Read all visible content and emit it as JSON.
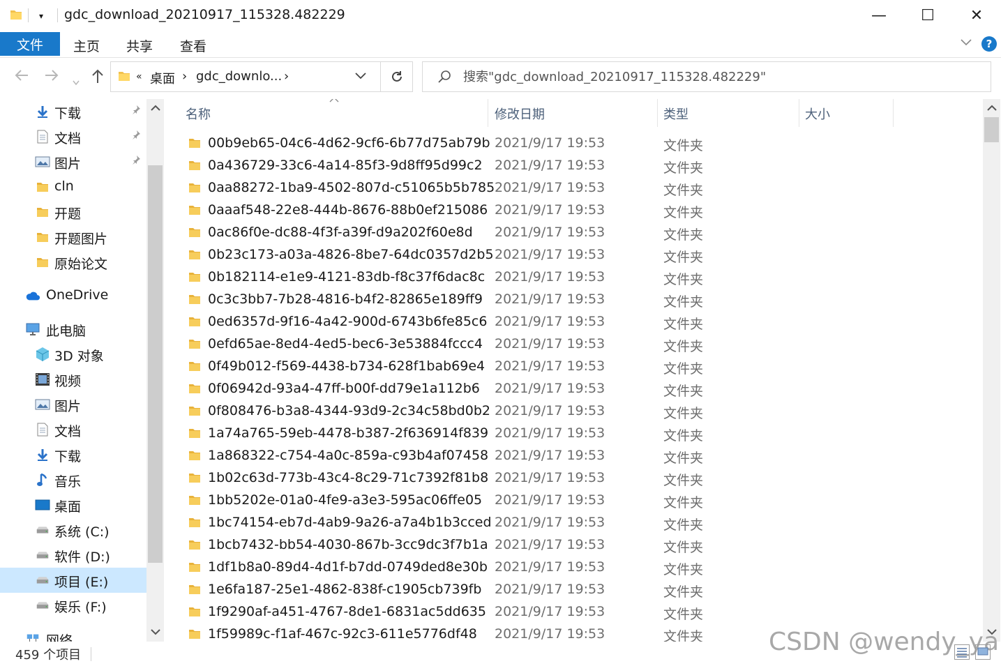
{
  "window": {
    "title": "gdc_download_20210917_115328.482229",
    "minimize": "—",
    "maximize": "☐",
    "close": "✕"
  },
  "ribbon": {
    "tabs": [
      "文件",
      "主页",
      "共享",
      "查看"
    ],
    "help": "?"
  },
  "address": {
    "overflow": "«",
    "crumbs": [
      "桌面",
      "gdc_downlo..."
    ],
    "sep": "›"
  },
  "search": {
    "placeholder": "搜索\"gdc_download_20210917_115328.482229\""
  },
  "nav": {
    "items": [
      {
        "label": "下载",
        "icon": "download-arrow-icon",
        "pinned": true
      },
      {
        "label": "文档",
        "icon": "document-icon",
        "pinned": true
      },
      {
        "label": "图片",
        "icon": "picture-icon",
        "pinned": true
      },
      {
        "label": "cln",
        "icon": "folder-icon"
      },
      {
        "label": "开题",
        "icon": "folder-icon"
      },
      {
        "label": "开题图片",
        "icon": "folder-icon"
      },
      {
        "label": "原始论文",
        "icon": "folder-icon"
      },
      {
        "label": "OneDrive",
        "icon": "cloud-icon"
      },
      {
        "label": "此电脑",
        "icon": "computer-icon"
      },
      {
        "label": "3D 对象",
        "icon": "cube-3d-icon"
      },
      {
        "label": "视频",
        "icon": "video-icon"
      },
      {
        "label": "图片",
        "icon": "picture-icon"
      },
      {
        "label": "文档",
        "icon": "document-icon"
      },
      {
        "label": "下载",
        "icon": "download-arrow-icon"
      },
      {
        "label": "音乐",
        "icon": "music-note-icon"
      },
      {
        "label": "桌面",
        "icon": "desktop-icon"
      },
      {
        "label": "系统 (C:)",
        "icon": "drive-icon"
      },
      {
        "label": "软件 (D:)",
        "icon": "drive-icon"
      },
      {
        "label": "项目 (E:)",
        "icon": "drive-icon",
        "selected": true
      },
      {
        "label": "娱乐 (F:)",
        "icon": "drive-icon"
      },
      {
        "label": "网络",
        "icon": "network-icon"
      }
    ]
  },
  "columns": {
    "name": "名称",
    "date": "修改日期",
    "type": "类型",
    "size": "大小"
  },
  "files": [
    {
      "name": "00b9eb65-04c6-4d62-9cf6-6b77d75ab79b",
      "date": "2021/9/17 19:53",
      "type": "文件夹"
    },
    {
      "name": "0a436729-33c6-4a14-85f3-9d8ff95d99c2",
      "date": "2021/9/17 19:53",
      "type": "文件夹"
    },
    {
      "name": "0aa88272-1ba9-4502-807d-c51065b5b785",
      "date": "2021/9/17 19:53",
      "type": "文件夹"
    },
    {
      "name": "0aaaf548-22e8-444b-8676-88b0ef215086",
      "date": "2021/9/17 19:53",
      "type": "文件夹"
    },
    {
      "name": "0ac86f0e-dc88-4f3f-a39f-d9a202f60e8d",
      "date": "2021/9/17 19:53",
      "type": "文件夹"
    },
    {
      "name": "0b23c173-a03a-4826-8be7-64dc0357d2b5",
      "date": "2021/9/17 19:53",
      "type": "文件夹"
    },
    {
      "name": "0b182114-e1e9-4121-83db-f8c37f6dac8c",
      "date": "2021/9/17 19:53",
      "type": "文件夹"
    },
    {
      "name": "0c3c3bb7-7b28-4816-b4f2-82865e189ff9",
      "date": "2021/9/17 19:53",
      "type": "文件夹"
    },
    {
      "name": "0ed6357d-9f16-4a42-900d-6743b6fe85c6",
      "date": "2021/9/17 19:53",
      "type": "文件夹"
    },
    {
      "name": "0efd65ae-8ed4-4ed5-bec6-3e53884fccc4",
      "date": "2021/9/17 19:53",
      "type": "文件夹"
    },
    {
      "name": "0f49b012-f569-4438-b734-628f1bab69e4",
      "date": "2021/9/17 19:53",
      "type": "文件夹"
    },
    {
      "name": "0f06942d-93a4-47ff-b00f-dd79e1a112b6",
      "date": "2021/9/17 19:53",
      "type": "文件夹"
    },
    {
      "name": "0f808476-b3a8-4344-93d9-2c34c58bd0b2",
      "date": "2021/9/17 19:53",
      "type": "文件夹"
    },
    {
      "name": "1a74a765-59eb-4478-b387-2f636914f839",
      "date": "2021/9/17 19:53",
      "type": "文件夹"
    },
    {
      "name": "1a868322-c754-4a0c-859a-c93b4af07458",
      "date": "2021/9/17 19:53",
      "type": "文件夹"
    },
    {
      "name": "1b02c63d-773b-43c4-8c29-71c7392f81b8",
      "date": "2021/9/17 19:53",
      "type": "文件夹"
    },
    {
      "name": "1bb5202e-01a0-4fe9-a3e3-595ac06ffe05",
      "date": "2021/9/17 19:53",
      "type": "文件夹"
    },
    {
      "name": "1bc74154-eb7d-4ab9-9a26-a7a4b1b3cced",
      "date": "2021/9/17 19:53",
      "type": "文件夹"
    },
    {
      "name": "1bcb7432-bb54-4030-867b-3cc9dc3f7b1a",
      "date": "2021/9/17 19:53",
      "type": "文件夹"
    },
    {
      "name": "1df1b8a0-89d4-4d1f-b7dd-0749ded8e30b",
      "date": "2021/9/17 19:53",
      "type": "文件夹"
    },
    {
      "name": "1e6fa187-25e1-4862-838f-c1905cb739fb",
      "date": "2021/9/17 19:53",
      "type": "文件夹"
    },
    {
      "name": "1f9290af-a451-4767-8de1-6831ac5dd635",
      "date": "2021/9/17 19:53",
      "type": "文件夹"
    },
    {
      "name": "1f59989c-f1af-467c-92c3-611e5776df48",
      "date": "2021/9/17 19:53",
      "type": "文件夹"
    }
  ],
  "status": {
    "count": "459 个项目"
  },
  "watermark": "CSDN @wendy_ya",
  "colors": {
    "accent": "#1979ca",
    "folder": "#f2c14e",
    "selected": "#cce8ff"
  }
}
